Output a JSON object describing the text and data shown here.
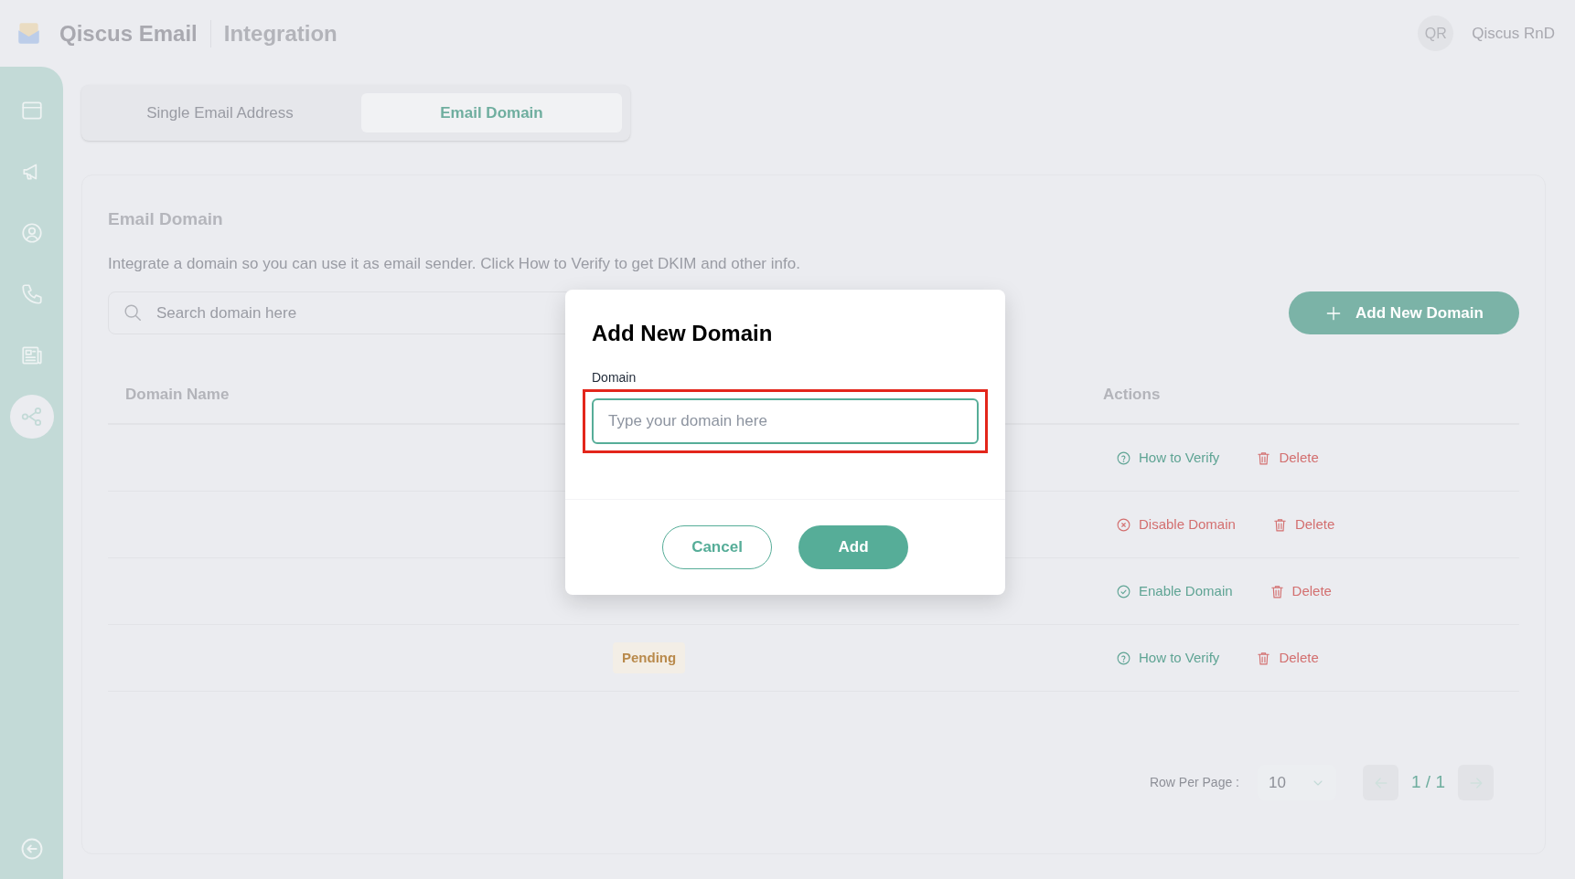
{
  "app": {
    "brand": "Qiscus Email",
    "section": "Integration",
    "user_initials": "QR",
    "user_name": "Qiscus RnD"
  },
  "sidebar": {
    "items": [
      {
        "kind": "window",
        "selected": false
      },
      {
        "kind": "megaphone",
        "selected": false
      },
      {
        "kind": "user",
        "selected": false
      },
      {
        "kind": "phone",
        "selected": false
      },
      {
        "kind": "news",
        "selected": false
      },
      {
        "kind": "share",
        "selected": true
      }
    ],
    "footer": {
      "kind": "collapse"
    }
  },
  "tabs": [
    {
      "label": "Single Email Address",
      "selected": false
    },
    {
      "label": "Email Domain",
      "selected": true
    }
  ],
  "section": {
    "title": "Email Domain",
    "description": "Integrate a domain so you can use it as email sender. Click How to Verify to get DKIM and other info."
  },
  "search": {
    "placeholder": "Search domain here"
  },
  "add_button": "Add New Domain",
  "table": {
    "columns": [
      {
        "label": "Domain Name"
      },
      {
        "label": "Actions"
      }
    ],
    "rows": [
      {
        "actions": [
          {
            "kind": "verify",
            "label": "How to Verify"
          },
          {
            "kind": "delete",
            "label": "Delete"
          }
        ]
      },
      {
        "actions": [
          {
            "kind": "disable",
            "label": "Disable Domain"
          },
          {
            "kind": "delete",
            "label": "Delete"
          }
        ]
      },
      {
        "actions": [
          {
            "kind": "enable",
            "label": "Enable Domain"
          },
          {
            "kind": "delete",
            "label": "Delete"
          }
        ]
      },
      {
        "status": "Pending",
        "actions": [
          {
            "kind": "verify",
            "label": "How to Verify"
          },
          {
            "kind": "delete",
            "label": "Delete"
          }
        ]
      }
    ]
  },
  "pagination": {
    "rows_label": "Row Per Page :",
    "page_size": "10",
    "page": "1 / 1"
  },
  "modal": {
    "title": "Add New Domain",
    "field_label": "Domain",
    "placeholder": "Type your domain here",
    "highlighted": true,
    "buttons": [
      {
        "kind": "secondary",
        "label": "Cancel"
      },
      {
        "kind": "primary",
        "label": "Add"
      }
    ]
  }
}
